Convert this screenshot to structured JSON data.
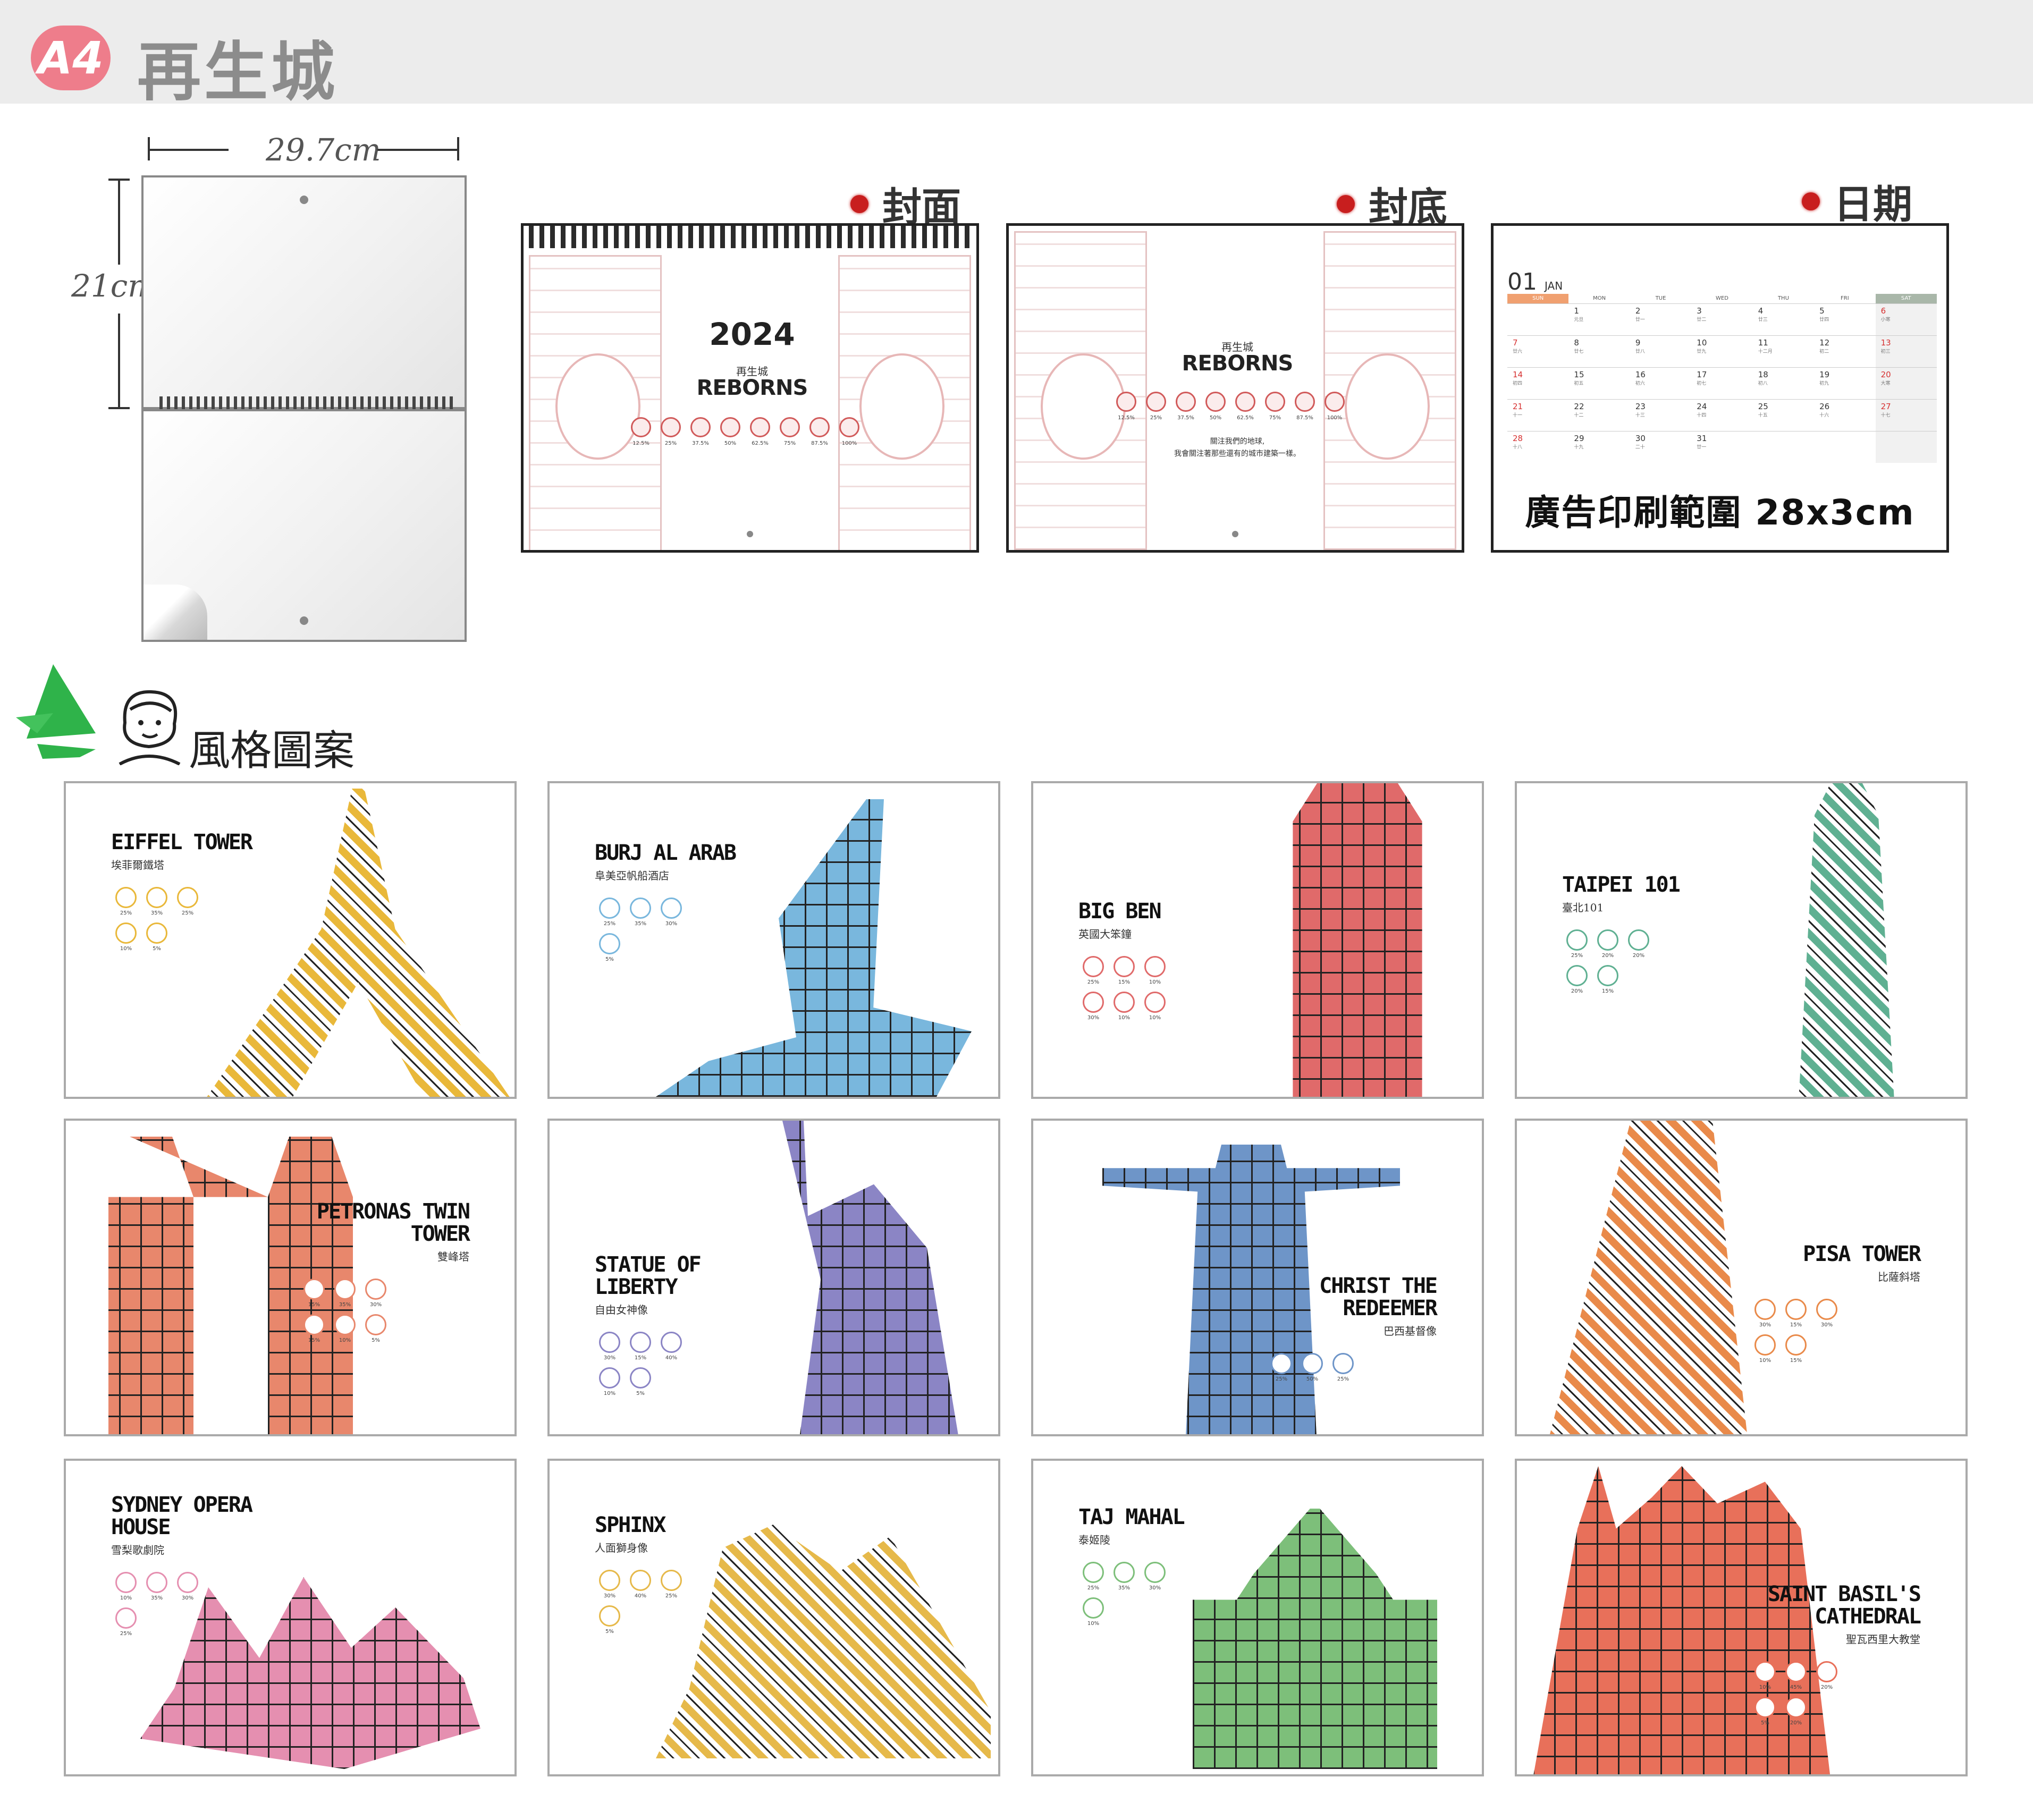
{
  "header": {
    "badge": "A4",
    "title": "再生城"
  },
  "mockup": {
    "width_label": "29.7cm",
    "height_label": "21cm"
  },
  "previews": [
    {
      "label": "封面",
      "year": "2024",
      "sub": "再生城",
      "brand": "REBORNS",
      "percents": [
        "12.5%",
        "25%",
        "37.5%",
        "50%",
        "62.5%",
        "75%",
        "87.5%",
        "100%"
      ]
    },
    {
      "label": "封底",
      "sub": "再生城",
      "brand": "REBORNS",
      "percents": [
        "12.5%",
        "25%",
        "37.5%",
        "50%",
        "62.5%",
        "75%",
        "87.5%",
        "100%"
      ],
      "note1": "關注我們的地球,",
      "note2": "我會關注著那些還有的城市建築一樣。"
    },
    {
      "label": "日期"
    }
  ],
  "calendar": {
    "month": "01",
    "month_name": "JAN",
    "weekdays": [
      "SUN",
      "MON",
      "TUE",
      "WED",
      "THU",
      "FRI",
      "SAT"
    ],
    "rows": [
      [
        {
          "d": "",
          "l": ""
        },
        {
          "d": "1",
          "l": "元旦"
        },
        {
          "d": "2",
          "l": "廿一"
        },
        {
          "d": "3",
          "l": "廿二"
        },
        {
          "d": "4",
          "l": "廿三"
        },
        {
          "d": "5",
          "l": "廿四"
        },
        {
          "d": "6",
          "l": "小寒"
        }
      ],
      [
        {
          "d": "7",
          "l": "廿六"
        },
        {
          "d": "8",
          "l": "廿七"
        },
        {
          "d": "9",
          "l": "廿八"
        },
        {
          "d": "10",
          "l": "廿九"
        },
        {
          "d": "11",
          "l": "十二月"
        },
        {
          "d": "12",
          "l": "初二"
        },
        {
          "d": "13",
          "l": "初三"
        }
      ],
      [
        {
          "d": "14",
          "l": "初四"
        },
        {
          "d": "15",
          "l": "初五"
        },
        {
          "d": "16",
          "l": "初六"
        },
        {
          "d": "17",
          "l": "初七"
        },
        {
          "d": "18",
          "l": "初八"
        },
        {
          "d": "19",
          "l": "初九"
        },
        {
          "d": "20",
          "l": "大寒"
        }
      ],
      [
        {
          "d": "21",
          "l": "十一"
        },
        {
          "d": "22",
          "l": "十二"
        },
        {
          "d": "23",
          "l": "十三"
        },
        {
          "d": "24",
          "l": "十四"
        },
        {
          "d": "25",
          "l": "十五"
        },
        {
          "d": "26",
          "l": "十六"
        },
        {
          "d": "27",
          "l": "十七"
        }
      ],
      [
        {
          "d": "28",
          "l": "十八"
        },
        {
          "d": "29",
          "l": "十九"
        },
        {
          "d": "30",
          "l": "二十"
        },
        {
          "d": "31",
          "l": "廿一"
        },
        {
          "d": "",
          "l": ""
        },
        {
          "d": "",
          "l": ""
        },
        {
          "d": "",
          "l": ""
        }
      ]
    ],
    "ad_range": "廣告印刷範圍 28x3cm"
  },
  "style_section": {
    "title": "風格圖案"
  },
  "designs": [
    {
      "name": "EIFFEL TOWER",
      "cn": "埃菲爾鐵塔",
      "color": "#e9b83a",
      "pcts": [
        "25%",
        "35%",
        "25%",
        "10%",
        "5%"
      ]
    },
    {
      "name": "BURJ AL ARAB",
      "cn": "阜美亞帆船酒店",
      "color": "#79b7dd",
      "pcts": [
        "25%",
        "35%",
        "30%",
        "5%"
      ]
    },
    {
      "name": "BIG BEN",
      "cn": "英國大笨鐘",
      "color": "#e06a6a",
      "pcts": [
        "25%",
        "15%",
        "10%",
        "30%",
        "10%",
        "10%"
      ]
    },
    {
      "name": "TAIPEI 101",
      "cn": "臺北101",
      "color": "#5fb092",
      "pcts": [
        "25%",
        "20%",
        "20%",
        "20%",
        "15%"
      ]
    },
    {
      "name": "PETRONAS TWIN TOWER",
      "cn": "雙峰塔",
      "color": "#e8876c",
      "pcts": [
        "15%",
        "35%",
        "30%",
        "15%",
        "10%",
        "5%"
      ]
    },
    {
      "name": "STATUE OF LIBERTY",
      "cn": "自由女神像",
      "color": "#8b85c5",
      "pcts": [
        "30%",
        "15%",
        "40%",
        "10%",
        "5%"
      ]
    },
    {
      "name": "CHRIST THE REDEEMER",
      "cn": "巴西基督像",
      "color": "#6e95c8",
      "pcts": [
        "25%",
        "50%",
        "25%"
      ]
    },
    {
      "name": "PISA TOWER",
      "cn": "比薩斜塔",
      "color": "#e98a4a",
      "pcts": [
        "30%",
        "15%",
        "30%",
        "10%",
        "15%"
      ]
    },
    {
      "name": "SYDNEY OPERA HOUSE",
      "cn": "雪梨歌劇院",
      "color": "#e58fb0",
      "pcts": [
        "10%",
        "35%",
        "30%",
        "25%"
      ]
    },
    {
      "name": "SPHINX",
      "cn": "人面獅身像",
      "color": "#e6b94a",
      "pcts": [
        "30%",
        "40%",
        "25%",
        "5%"
      ]
    },
    {
      "name": "TAJ MAHAL",
      "cn": "泰姬陵",
      "color": "#7dbf7a",
      "pcts": [
        "25%",
        "35%",
        "30%",
        "10%"
      ]
    },
    {
      "name": "SAINT BASIL'S CATHEDRAL",
      "cn": "聖瓦西里大教堂",
      "color": "#e8705a",
      "pcts": [
        "10%",
        "45%",
        "20%",
        "5%",
        "20%"
      ]
    }
  ]
}
